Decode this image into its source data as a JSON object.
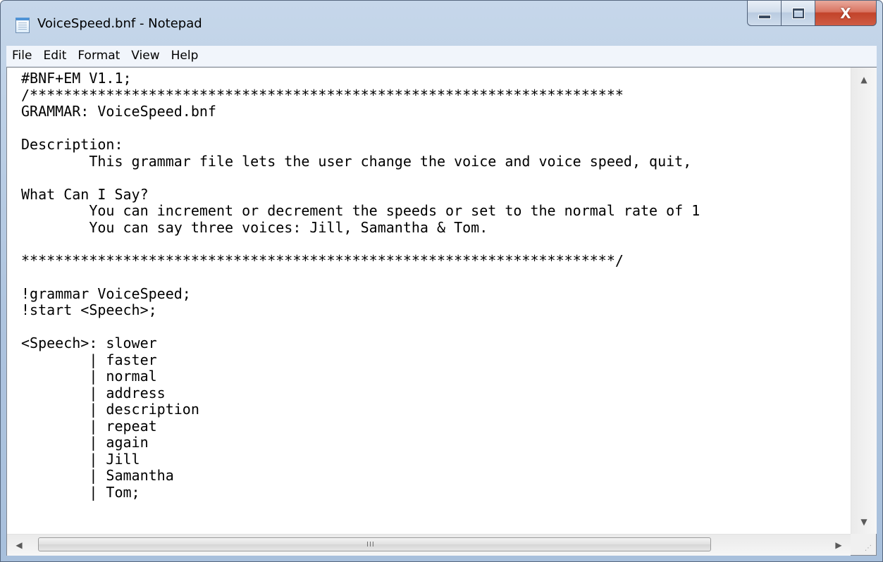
{
  "window": {
    "title": "VoiceSpeed.bnf - Notepad",
    "icon": "notepad-icon"
  },
  "caption": {
    "minimize_icon": "minimize-icon",
    "maximize_icon": "maximize-icon",
    "close_glyph": "X"
  },
  "menu": {
    "items": [
      "File",
      "Edit",
      "Format",
      "View",
      "Help"
    ]
  },
  "editor": {
    "text": "#BNF+EM V1.1;\n/**********************************************************************\nGRAMMAR: VoiceSpeed.bnf\n\nDescription:\n        This grammar file lets the user change the voice and voice speed, quit,\n\nWhat Can I Say?\n        You can increment or decrement the speeds or set to the normal rate of 1\n        You can say three voices: Jill, Samantha & Tom.\n\n**********************************************************************/\n\n!grammar VoiceSpeed;\n!start <Speech>;\n\n<Speech>: slower\n        | faster\n        | normal\n        | address\n        | description\n        | repeat\n        | again\n        | Jill\n        | Samantha\n        | Tom;"
  },
  "scrollbars": {
    "up_arrow": "▲",
    "down_arrow": "▼",
    "left_arrow": "◀",
    "right_arrow": "▶",
    "thumb_grip": "III"
  },
  "colors": {
    "title_bar": "#b9cde4",
    "close_button": "#c2432a",
    "menu_bar": "#f1f5fb"
  }
}
